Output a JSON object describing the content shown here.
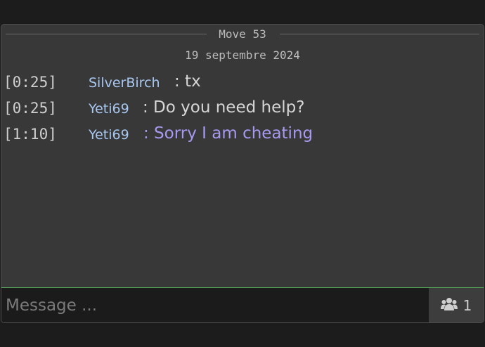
{
  "chat": {
    "move_label": "Move 53",
    "date_label": "19 septembre 2024",
    "messages": [
      {
        "time": "[0:25]",
        "author": "SilverBirch",
        "text": ": tx"
      },
      {
        "time": "[0:25]",
        "author": "Yeti69",
        "text": ": Do you need help?"
      },
      {
        "time": "[1:10]",
        "author": "Yeti69",
        "text": ": Sorry I am cheating"
      }
    ]
  },
  "input": {
    "placeholder": "Message ..."
  },
  "spectators": {
    "icon": "users-icon",
    "count": "1"
  },
  "colors": {
    "author": "#a7c7f0",
    "highlight_text": "#a59af0",
    "input_accent": "#56a95c"
  }
}
